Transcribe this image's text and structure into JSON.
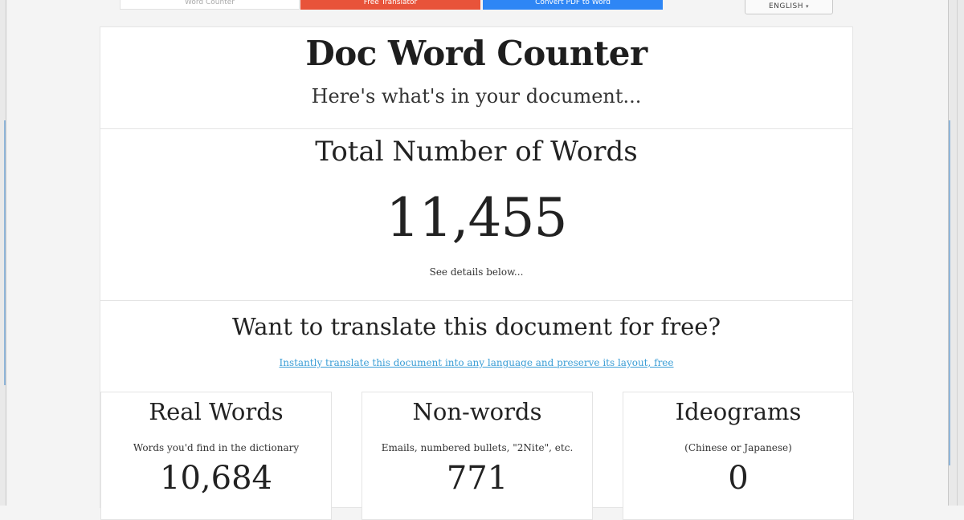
{
  "nav": {
    "tabs": [
      {
        "label": "Word Counter"
      },
      {
        "label": "Free Translator"
      },
      {
        "label": "Convert PDF to Word"
      }
    ],
    "language_label": "ENGLISH"
  },
  "header": {
    "title": "Doc Word Counter",
    "subtitle": "Here's what's in your document..."
  },
  "total": {
    "heading": "Total Number of Words",
    "value": "11,455",
    "note": "See details below..."
  },
  "translate": {
    "heading": "Want to translate this document for free?",
    "link_text": "Instantly translate this document into any language and preserve its layout, free"
  },
  "stats": [
    {
      "title": "Real Words",
      "description": "Words you'd find in the dictionary",
      "value": "10,684"
    },
    {
      "title": "Non-words",
      "description": "Emails, numbered bullets, \"2Nite\", etc.",
      "value": "771"
    },
    {
      "title": "Ideograms",
      "description": "(Chinese or Japanese)",
      "value": "0"
    }
  ],
  "colors": {
    "translator_tab": "#e8533a",
    "convert_tab": "#2e86f5",
    "link": "#3b9ed6"
  },
  "icons": {
    "language_caret": "chevron-down-icon"
  }
}
